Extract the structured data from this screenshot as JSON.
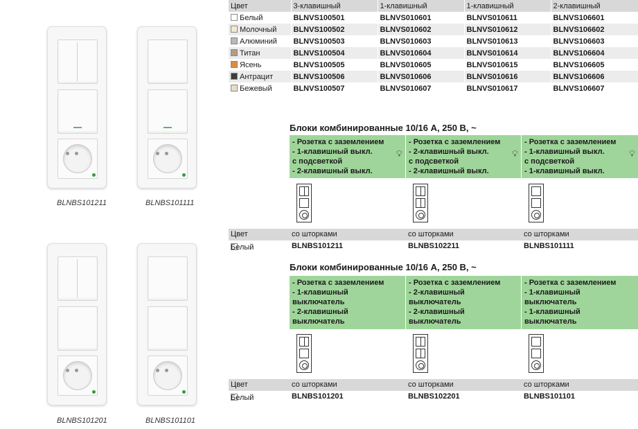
{
  "top_table": {
    "header": [
      "Цвет",
      "3-клавишный",
      "1-клавишный",
      "1-клавишный",
      "2-клавишный"
    ],
    "rows": [
      {
        "color": "Белый",
        "swatch": "#ffffff",
        "codes": [
          "BLNVS100501",
          "BLNVS010601",
          "BLNVS010611",
          "BLNVS106601"
        ]
      },
      {
        "color": "Молочный",
        "swatch": "#f3e9d2",
        "codes": [
          "BLNVS100502",
          "BLNVS010602",
          "BLNVS010612",
          "BLNVS106602"
        ]
      },
      {
        "color": "Алюминий",
        "swatch": "#b8b8b8",
        "codes": [
          "BLNVS100503",
          "BLNVS010603",
          "BLNVS010613",
          "BLNVS106603"
        ]
      },
      {
        "color": "Титан",
        "swatch": "#b39b84",
        "codes": [
          "BLNVS100504",
          "BLNVS010604",
          "BLNVS010614",
          "BLNVS106604"
        ]
      },
      {
        "color": "Ясень",
        "swatch": "#e08a3c",
        "codes": [
          "BLNVS100505",
          "BLNVS010605",
          "BLNVS010615",
          "BLNVS106605"
        ]
      },
      {
        "color": "Антрацит",
        "swatch": "#3d3d3d",
        "codes": [
          "BLNVS100506",
          "BLNVS010606",
          "BLNVS010616",
          "BLNVS106606"
        ]
      },
      {
        "color": "Бежевый",
        "swatch": "#e6dcc8",
        "codes": [
          "BLNVS100507",
          "BLNVS010607",
          "BLNVS010617",
          "BLNVS106607"
        ]
      }
    ]
  },
  "block1": {
    "title": "Блоки комбинированные 10/16 А, 250 В, ~",
    "features": [
      [
        "- Розетка с заземлением",
        "- 1-клавишный выкл.",
        "с подсветкой",
        "- 2-клавишный выкл."
      ],
      [
        "- Розетка с заземлением",
        "- 2-клавишный выкл.",
        "с подсветкой",
        "- 2-клавишный выкл."
      ],
      [
        "- Розетка с заземлением",
        "- 1-клавишный выкл.",
        "с подсветкой",
        "- 1-клавишный выкл."
      ]
    ],
    "header": [
      "Цвет",
      "со шторками",
      "со шторками",
      "со шторками"
    ],
    "row": {
      "color": "Белый",
      "codes": [
        "BLNBS101211",
        "BLNBS102211",
        "BLNBS101111"
      ]
    }
  },
  "block2": {
    "title": "Блоки комбинированные 10/16 А, 250 В, ~",
    "features": [
      [
        "- Розетка с заземлением",
        "- 1-клавишный",
        "выключатель",
        "- 2-клавишный",
        "выключатель"
      ],
      [
        "- Розетка с заземлением",
        "- 2-клавишный",
        "выключатель",
        "- 2-клавишный",
        "выключатель"
      ],
      [
        "- Розетка с заземлением",
        "- 1-клавишный",
        "выключатель",
        "- 1-клавишный",
        "выключатель"
      ]
    ],
    "header": [
      "Цвет",
      "со шторками",
      "со шторками",
      "со шторками"
    ],
    "row": {
      "color": "Белый",
      "codes": [
        "BLNBS101201",
        "BLNBS102201",
        "BLNBS101101"
      ]
    }
  },
  "photos": {
    "labels": [
      "BLNBS101211",
      "BLNBS101111",
      "BLNBS101201",
      "BLNBS101101"
    ]
  },
  "icons": {
    "bulb": "lightbulb-icon",
    "diagram": "switch-socket-diagram-icon"
  },
  "colors": {
    "feature_bg": "#9fd59a",
    "header_bg": "#d8d8d8",
    "stripe": "#ececec"
  }
}
